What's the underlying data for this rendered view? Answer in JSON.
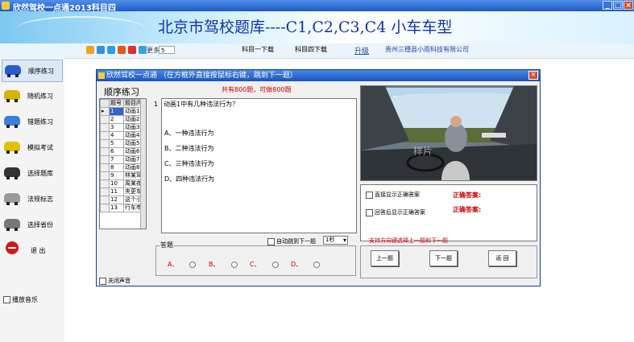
{
  "window": {
    "title": "欣然驾校一点通2013科目四"
  },
  "banner": {
    "title": "北京市驾校题库----C1,C2,C3,C4 小车车型"
  },
  "toolbar": {
    "more_label": "更多",
    "more_value": "5",
    "links": [
      "科目一下载",
      "科目四下载",
      "升级",
      "贵州三穗县小雨科技有限公司"
    ]
  },
  "sidebar": {
    "items": [
      {
        "label": "顺序练习",
        "color": "#2a5bd0"
      },
      {
        "label": "随机练习",
        "color": "#d6b400"
      },
      {
        "label": "错题练习",
        "color": "#3b7ee0"
      },
      {
        "label": "模拟考试",
        "color": "#e2c000"
      },
      {
        "label": "选择题库",
        "color": "#333333"
      },
      {
        "label": "法规标志",
        "color": "#9a9a9a"
      },
      {
        "label": "选择省份",
        "color": "#777777"
      },
      {
        "label": "退  出",
        "color": "#d01818"
      }
    ],
    "music_label": "播放音乐"
  },
  "dialog": {
    "title": "欣然驾校一点通  （在方框外直接按鼠标右键，跳到下一题）",
    "list_title": "顺序练习",
    "question_count": "共有800题，可做800题",
    "grid": {
      "headers": [
        "题号",
        "题目内"
      ],
      "rows": [
        [
          "1",
          "动画1"
        ],
        [
          "2",
          "动画2"
        ],
        [
          "3",
          "动画3"
        ],
        [
          "4",
          "动画4"
        ],
        [
          "5",
          "动画5"
        ],
        [
          "6",
          "动画6"
        ],
        [
          "7",
          "动画7"
        ],
        [
          "8",
          "动画8"
        ],
        [
          "9",
          "林某驾"
        ],
        [
          "10",
          "周某夜"
        ],
        [
          "11",
          "夹更车"
        ],
        [
          "12",
          "这个小"
        ],
        [
          "13",
          "行车申"
        ]
      ]
    },
    "question_number": "1",
    "question_text": "动画1中有几种违法行为？",
    "options": [
      "A、一种违法行为",
      "B、二种违法行为",
      "C、三种违法行为",
      "D、四种违法行为"
    ],
    "image_watermark": "样片",
    "show_answer_label": "直接显示正确答案",
    "after_answer_label": "回答后显示正确答案",
    "correct_label_1": "正确答案:",
    "correct_label_2": "正确答案:",
    "sound_label": "关闭声音",
    "auto_next_label": "自动跳到下一题",
    "seconds": "1秒",
    "hint": "支持方向键选择上一题和下一题",
    "answer_legend": "答题",
    "choices": [
      "A、",
      "B、",
      "C、",
      "D、"
    ],
    "buttons": {
      "prev": "上一题",
      "next": "下一题",
      "back": "返 回"
    }
  }
}
